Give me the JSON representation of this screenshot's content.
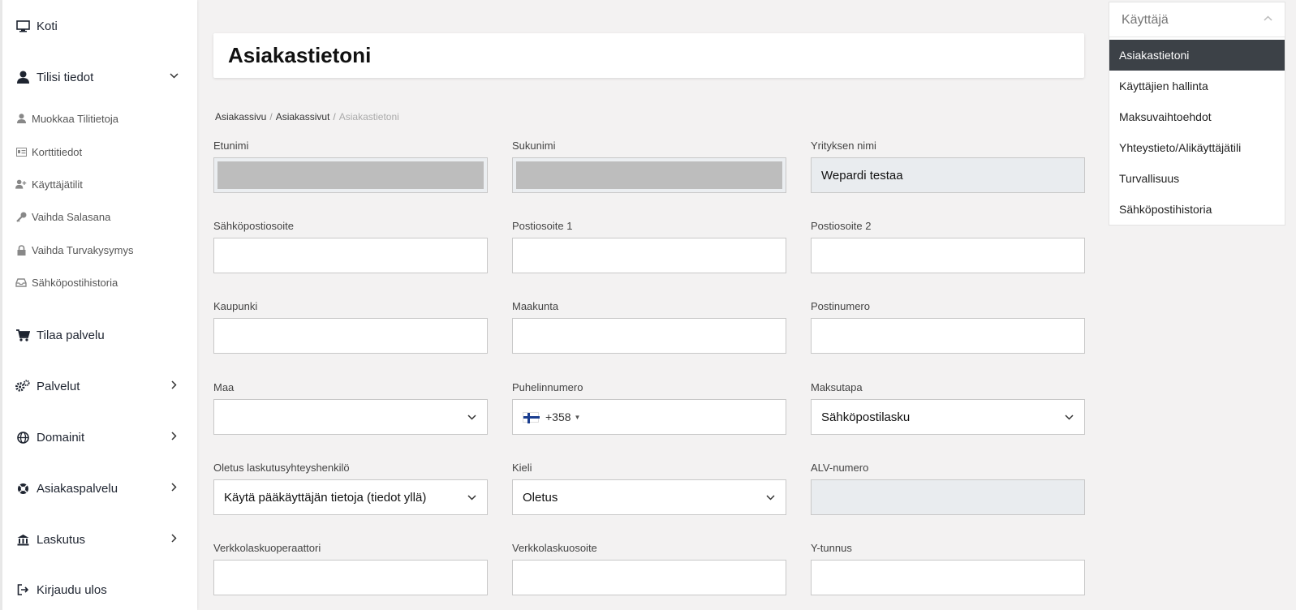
{
  "sidebar": {
    "koti": "Koti",
    "tilisi": "Tilisi tiedot",
    "sub": {
      "muokkaa": "Muokkaa Tilitietoja",
      "kortti": "Korttitiedot",
      "kayttajatilit": "Käyttäjätilit",
      "salasana": "Vaihda Salasana",
      "turvakysymys": "Vaihda Turvakysymys",
      "sahkoposti": "Sähköpostihistoria"
    },
    "tilaa": "Tilaa palvelu",
    "palvelut": "Palvelut",
    "domainit": "Domainit",
    "asiakaspalvelu": "Asiakaspalvelu",
    "laskutus": "Laskutus",
    "kirjaudu": "Kirjaudu ulos"
  },
  "main": {
    "title": "Asiakastietoni",
    "breadcrumb": [
      "Asiakassivu",
      "Asiakassivut",
      "Asiakastietoni"
    ],
    "fields": {
      "etunimi": {
        "label": "Etunimi"
      },
      "sukunimi": {
        "label": "Sukunimi"
      },
      "yritys": {
        "label": "Yrityksen nimi",
        "value": "Wepardi testaa"
      },
      "email": {
        "label": "Sähköpostiosoite"
      },
      "post1": {
        "label": "Postiosoite 1"
      },
      "post2": {
        "label": "Postiosoite 2"
      },
      "kaupunki": {
        "label": "Kaupunki"
      },
      "maakunta": {
        "label": "Maakunta"
      },
      "postinumero": {
        "label": "Postinumero"
      },
      "maa": {
        "label": "Maa"
      },
      "puhelin": {
        "label": "Puhelinnumero",
        "dial_code": "+358"
      },
      "maksutapa": {
        "label": "Maksutapa",
        "value": "Sähköpostilasku"
      },
      "oletus": {
        "label": "Oletus laskutusyhteyshenkilö",
        "value": "Käytä pääkäyttäjän tietoja (tiedot yllä)"
      },
      "kieli": {
        "label": "Kieli",
        "value": "Oletus"
      },
      "alv": {
        "label": "ALV-numero"
      },
      "operaattori": {
        "label": "Verkkolaskuoperaattori"
      },
      "verkkoosoite": {
        "label": "Verkkolaskuosoite"
      },
      "ytunnus": {
        "label": "Y-tunnus"
      }
    }
  },
  "right_panel": {
    "title": "Käyttäjä",
    "items": [
      "Asiakastietoni",
      "Käyttäjien hallinta",
      "Maksuvaihtoehdot",
      "Yhteystieto/Alikäyttäjätili",
      "Turvallisuus",
      "Sähköpostihistoria"
    ]
  }
}
